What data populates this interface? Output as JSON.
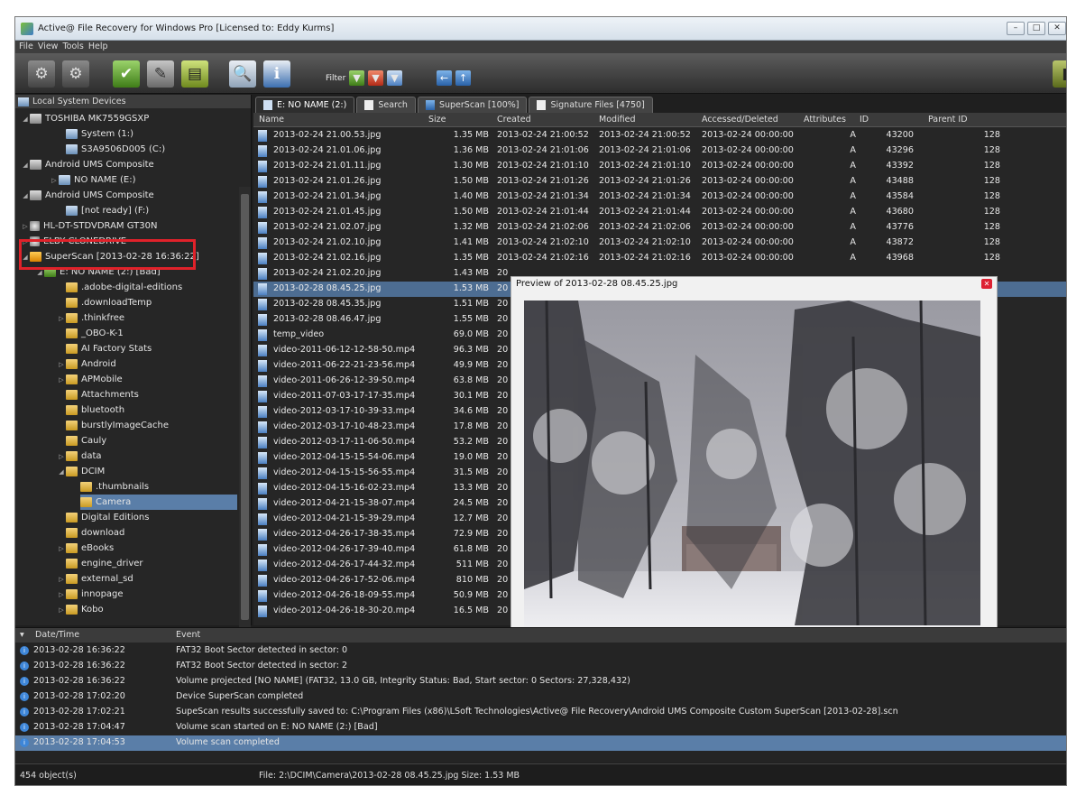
{
  "window": {
    "title": "Active@ File Recovery for Windows Pro [Licensed to: Eddy Kurms]"
  },
  "menu": [
    "File",
    "View",
    "Tools",
    "Help"
  ],
  "toolbar": {
    "filter_label": "Filter"
  },
  "tree": {
    "header": "Local System Devices",
    "items": [
      {
        "label": "TOSHIBA MK7559GSXP",
        "icon": "hard-disk-icon"
      },
      {
        "label": "System (1:)",
        "icon": "volume-icon"
      },
      {
        "label": "S3A9506D005 (C:)",
        "icon": "volume-icon"
      },
      {
        "label": "Android UMS Composite",
        "icon": "device-icon"
      },
      {
        "label": "NO NAME (E:)",
        "icon": "volume-icon"
      },
      {
        "label": "Android UMS Composite",
        "icon": "device-icon"
      },
      {
        "label": "[not ready] (F:)",
        "icon": "volume-icon"
      },
      {
        "label": "HL-DT-STDVDRAM GT30N",
        "icon": "optical-drive-icon"
      },
      {
        "label": "ELBY   CLONEDRIVE",
        "icon": "optical-drive-icon"
      },
      {
        "label": "SuperScan [2013-02-28 16:36:22]",
        "icon": "superscan-icon"
      },
      {
        "label": "E: NO NAME (2:) [Bad]",
        "icon": "volume-icon"
      },
      {
        "label": ".adobe-digital-editions",
        "icon": "folder-icon"
      },
      {
        "label": ".downloadTemp",
        "icon": "folder-icon"
      },
      {
        "label": ".thinkfree",
        "icon": "folder-icon"
      },
      {
        "label": "_OBO-K-1",
        "icon": "folder-icon"
      },
      {
        "label": "AI Factory Stats",
        "icon": "folder-icon"
      },
      {
        "label": "Android",
        "icon": "folder-icon"
      },
      {
        "label": "APMobile",
        "icon": "folder-icon"
      },
      {
        "label": "Attachments",
        "icon": "folder-icon"
      },
      {
        "label": "bluetooth",
        "icon": "folder-icon"
      },
      {
        "label": "burstlyImageCache",
        "icon": "folder-icon"
      },
      {
        "label": "Cauly",
        "icon": "folder-icon"
      },
      {
        "label": "data",
        "icon": "folder-icon"
      },
      {
        "label": "DCIM",
        "icon": "folder-icon"
      },
      {
        "label": ".thumbnails",
        "icon": "folder-icon"
      },
      {
        "label": "Camera",
        "icon": "folder-icon"
      },
      {
        "label": "Digital Editions",
        "icon": "folder-icon"
      },
      {
        "label": "download",
        "icon": "folder-icon"
      },
      {
        "label": "eBooks",
        "icon": "folder-icon"
      },
      {
        "label": "engine_driver",
        "icon": "folder-icon"
      },
      {
        "label": "external_sd",
        "icon": "folder-icon"
      },
      {
        "label": "innopage",
        "icon": "folder-icon"
      },
      {
        "label": "Kobo",
        "icon": "folder-icon"
      }
    ]
  },
  "tabs": [
    "E: NO NAME (2:)",
    "Search",
    "SuperScan [100%]",
    "Signature Files [4750]"
  ],
  "columns": [
    "Name",
    "Size",
    "Created",
    "Modified",
    "Accessed/Deleted",
    "Attributes",
    "ID",
    "Parent ID"
  ],
  "files": [
    {
      "name": "2013-02-24 21.00.53.jpg",
      "size": "1.35 MB",
      "created": "2013-02-24 21:00:52",
      "modified": "2013-02-24 21:00:52",
      "accessed": "2013-02-24 00:00:00",
      "attr": "A",
      "id": "43200",
      "parent": "128"
    },
    {
      "name": "2013-02-24 21.01.06.jpg",
      "size": "1.36 MB",
      "created": "2013-02-24 21:01:06",
      "modified": "2013-02-24 21:01:06",
      "accessed": "2013-02-24 00:00:00",
      "attr": "A",
      "id": "43296",
      "parent": "128"
    },
    {
      "name": "2013-02-24 21.01.11.jpg",
      "size": "1.30 MB",
      "created": "2013-02-24 21:01:10",
      "modified": "2013-02-24 21:01:10",
      "accessed": "2013-02-24 00:00:00",
      "attr": "A",
      "id": "43392",
      "parent": "128"
    },
    {
      "name": "2013-02-24 21.01.26.jpg",
      "size": "1.50 MB",
      "created": "2013-02-24 21:01:26",
      "modified": "2013-02-24 21:01:26",
      "accessed": "2013-02-24 00:00:00",
      "attr": "A",
      "id": "43488",
      "parent": "128"
    },
    {
      "name": "2013-02-24 21.01.34.jpg",
      "size": "1.40 MB",
      "created": "2013-02-24 21:01:34",
      "modified": "2013-02-24 21:01:34",
      "accessed": "2013-02-24 00:00:00",
      "attr": "A",
      "id": "43584",
      "parent": "128"
    },
    {
      "name": "2013-02-24 21.01.45.jpg",
      "size": "1.50 MB",
      "created": "2013-02-24 21:01:44",
      "modified": "2013-02-24 21:01:44",
      "accessed": "2013-02-24 00:00:00",
      "attr": "A",
      "id": "43680",
      "parent": "128"
    },
    {
      "name": "2013-02-24 21.02.07.jpg",
      "size": "1.32 MB",
      "created": "2013-02-24 21:02:06",
      "modified": "2013-02-24 21:02:06",
      "accessed": "2013-02-24 00:00:00",
      "attr": "A",
      "id": "43776",
      "parent": "128"
    },
    {
      "name": "2013-02-24 21.02.10.jpg",
      "size": "1.41 MB",
      "created": "2013-02-24 21:02:10",
      "modified": "2013-02-24 21:02:10",
      "accessed": "2013-02-24 00:00:00",
      "attr": "A",
      "id": "43872",
      "parent": "128"
    },
    {
      "name": "2013-02-24 21.02.16.jpg",
      "size": "1.35 MB",
      "created": "2013-02-24 21:02:16",
      "modified": "2013-02-24 21:02:16",
      "accessed": "2013-02-24 00:00:00",
      "attr": "A",
      "id": "43968",
      "parent": "128"
    },
    {
      "name": "2013-02-24 21.02.20.jpg",
      "size": "1.43 MB",
      "created": "20",
      "modified": "",
      "accessed": "",
      "attr": "",
      "id": "",
      "parent": ""
    },
    {
      "name": "2013-02-28 08.45.25.jpg",
      "size": "1.53 MB",
      "created": "20",
      "modified": "",
      "accessed": "",
      "attr": "",
      "id": "",
      "parent": ""
    },
    {
      "name": "2013-02-28 08.45.35.jpg",
      "size": "1.51 MB",
      "created": "20",
      "modified": "",
      "accessed": "",
      "attr": "",
      "id": "",
      "parent": ""
    },
    {
      "name": "2013-02-28 08.46.47.jpg",
      "size": "1.55 MB",
      "created": "20",
      "modified": "",
      "accessed": "",
      "attr": "",
      "id": "",
      "parent": ""
    },
    {
      "name": "temp_video",
      "size": "69.0 MB",
      "created": "20",
      "modified": "",
      "accessed": "",
      "attr": "",
      "id": "",
      "parent": ""
    },
    {
      "name": "video-2011-06-12-12-58-50.mp4",
      "size": "96.3 MB",
      "created": "20",
      "modified": "",
      "accessed": "",
      "attr": "",
      "id": "",
      "parent": ""
    },
    {
      "name": "video-2011-06-22-21-23-56.mp4",
      "size": "49.9 MB",
      "created": "20",
      "modified": "",
      "accessed": "",
      "attr": "",
      "id": "",
      "parent": ""
    },
    {
      "name": "video-2011-06-26-12-39-50.mp4",
      "size": "63.8 MB",
      "created": "20",
      "modified": "",
      "accessed": "",
      "attr": "",
      "id": "",
      "parent": ""
    },
    {
      "name": "video-2011-07-03-17-17-35.mp4",
      "size": "30.1 MB",
      "created": "20",
      "modified": "",
      "accessed": "",
      "attr": "",
      "id": "",
      "parent": ""
    },
    {
      "name": "video-2012-03-17-10-39-33.mp4",
      "size": "34.6 MB",
      "created": "20",
      "modified": "",
      "accessed": "",
      "attr": "",
      "id": "",
      "parent": ""
    },
    {
      "name": "video-2012-03-17-10-48-23.mp4",
      "size": "17.8 MB",
      "created": "20",
      "modified": "",
      "accessed": "",
      "attr": "",
      "id": "",
      "parent": ""
    },
    {
      "name": "video-2012-03-17-11-06-50.mp4",
      "size": "53.2 MB",
      "created": "20",
      "modified": "",
      "accessed": "",
      "attr": "",
      "id": "",
      "parent": ""
    },
    {
      "name": "video-2012-04-15-15-54-06.mp4",
      "size": "19.0 MB",
      "created": "20",
      "modified": "",
      "accessed": "",
      "attr": "",
      "id": "",
      "parent": ""
    },
    {
      "name": "video-2012-04-15-15-56-55.mp4",
      "size": "31.5 MB",
      "created": "20",
      "modified": "",
      "accessed": "",
      "attr": "",
      "id": "",
      "parent": ""
    },
    {
      "name": "video-2012-04-15-16-02-23.mp4",
      "size": "13.3 MB",
      "created": "20",
      "modified": "",
      "accessed": "",
      "attr": "",
      "id": "",
      "parent": ""
    },
    {
      "name": "video-2012-04-21-15-38-07.mp4",
      "size": "24.5 MB",
      "created": "20",
      "modified": "",
      "accessed": "",
      "attr": "",
      "id": "",
      "parent": ""
    },
    {
      "name": "video-2012-04-21-15-39-29.mp4",
      "size": "12.7 MB",
      "created": "20",
      "modified": "",
      "accessed": "",
      "attr": "",
      "id": "",
      "parent": ""
    },
    {
      "name": "video-2012-04-26-17-38-35.mp4",
      "size": "72.9 MB",
      "created": "20",
      "modified": "",
      "accessed": "",
      "attr": "",
      "id": "",
      "parent": ""
    },
    {
      "name": "video-2012-04-26-17-39-40.mp4",
      "size": "61.8 MB",
      "created": "20",
      "modified": "",
      "accessed": "",
      "attr": "",
      "id": "",
      "parent": ""
    },
    {
      "name": "video-2012-04-26-17-44-32.mp4",
      "size": "511 MB",
      "created": "20",
      "modified": "",
      "accessed": "",
      "attr": "",
      "id": "",
      "parent": ""
    },
    {
      "name": "video-2012-04-26-17-52-06.mp4",
      "size": "810 MB",
      "created": "20",
      "modified": "",
      "accessed": "",
      "attr": "",
      "id": "",
      "parent": ""
    },
    {
      "name": "video-2012-04-26-18-09-55.mp4",
      "size": "50.9 MB",
      "created": "20",
      "modified": "",
      "accessed": "",
      "attr": "",
      "id": "",
      "parent": ""
    },
    {
      "name": "video-2012-04-26-18-30-20.mp4",
      "size": "16.5 MB",
      "created": "20",
      "modified": "",
      "accessed": "",
      "attr": "",
      "id": "",
      "parent": ""
    }
  ],
  "preview": {
    "title": "Preview of 2013-02-28 08.45.25.jpg"
  },
  "log": {
    "columns": [
      "Date/Time",
      "Event"
    ],
    "rows": [
      {
        "time": "2013-02-28 16:36:22",
        "event": "FAT32 Boot Sector detected in sector: 0"
      },
      {
        "time": "2013-02-28 16:36:22",
        "event": "FAT32 Boot Sector detected in sector: 2"
      },
      {
        "time": "2013-02-28 16:36:22",
        "event": "Volume projected [NO NAME] (FAT32, 13.0 GB, Integrity Status: Bad, Start sector: 0 Sectors: 27,328,432)"
      },
      {
        "time": "2013-02-28 17:02:20",
        "event": "Device SuperScan completed"
      },
      {
        "time": "2013-02-28 17:02:21",
        "event": "SupeScan results successfully saved to: C:\\Program Files (x86)\\LSoft Technologies\\Active@ File Recovery\\Android UMS Composite Custom SuperScan [2013-02-28].scn"
      },
      {
        "time": "2013-02-28 17:04:47",
        "event": "Volume scan started on E: NO NAME (2:) [Bad]"
      },
      {
        "time": "2013-02-28 17:04:53",
        "event": "Volume scan completed"
      }
    ]
  },
  "status": {
    "count": "454 object(s)",
    "file": "File: 2:\\DCIM\\Camera\\2013-02-28 08.45.25.jpg  Size: 1.53 MB"
  }
}
